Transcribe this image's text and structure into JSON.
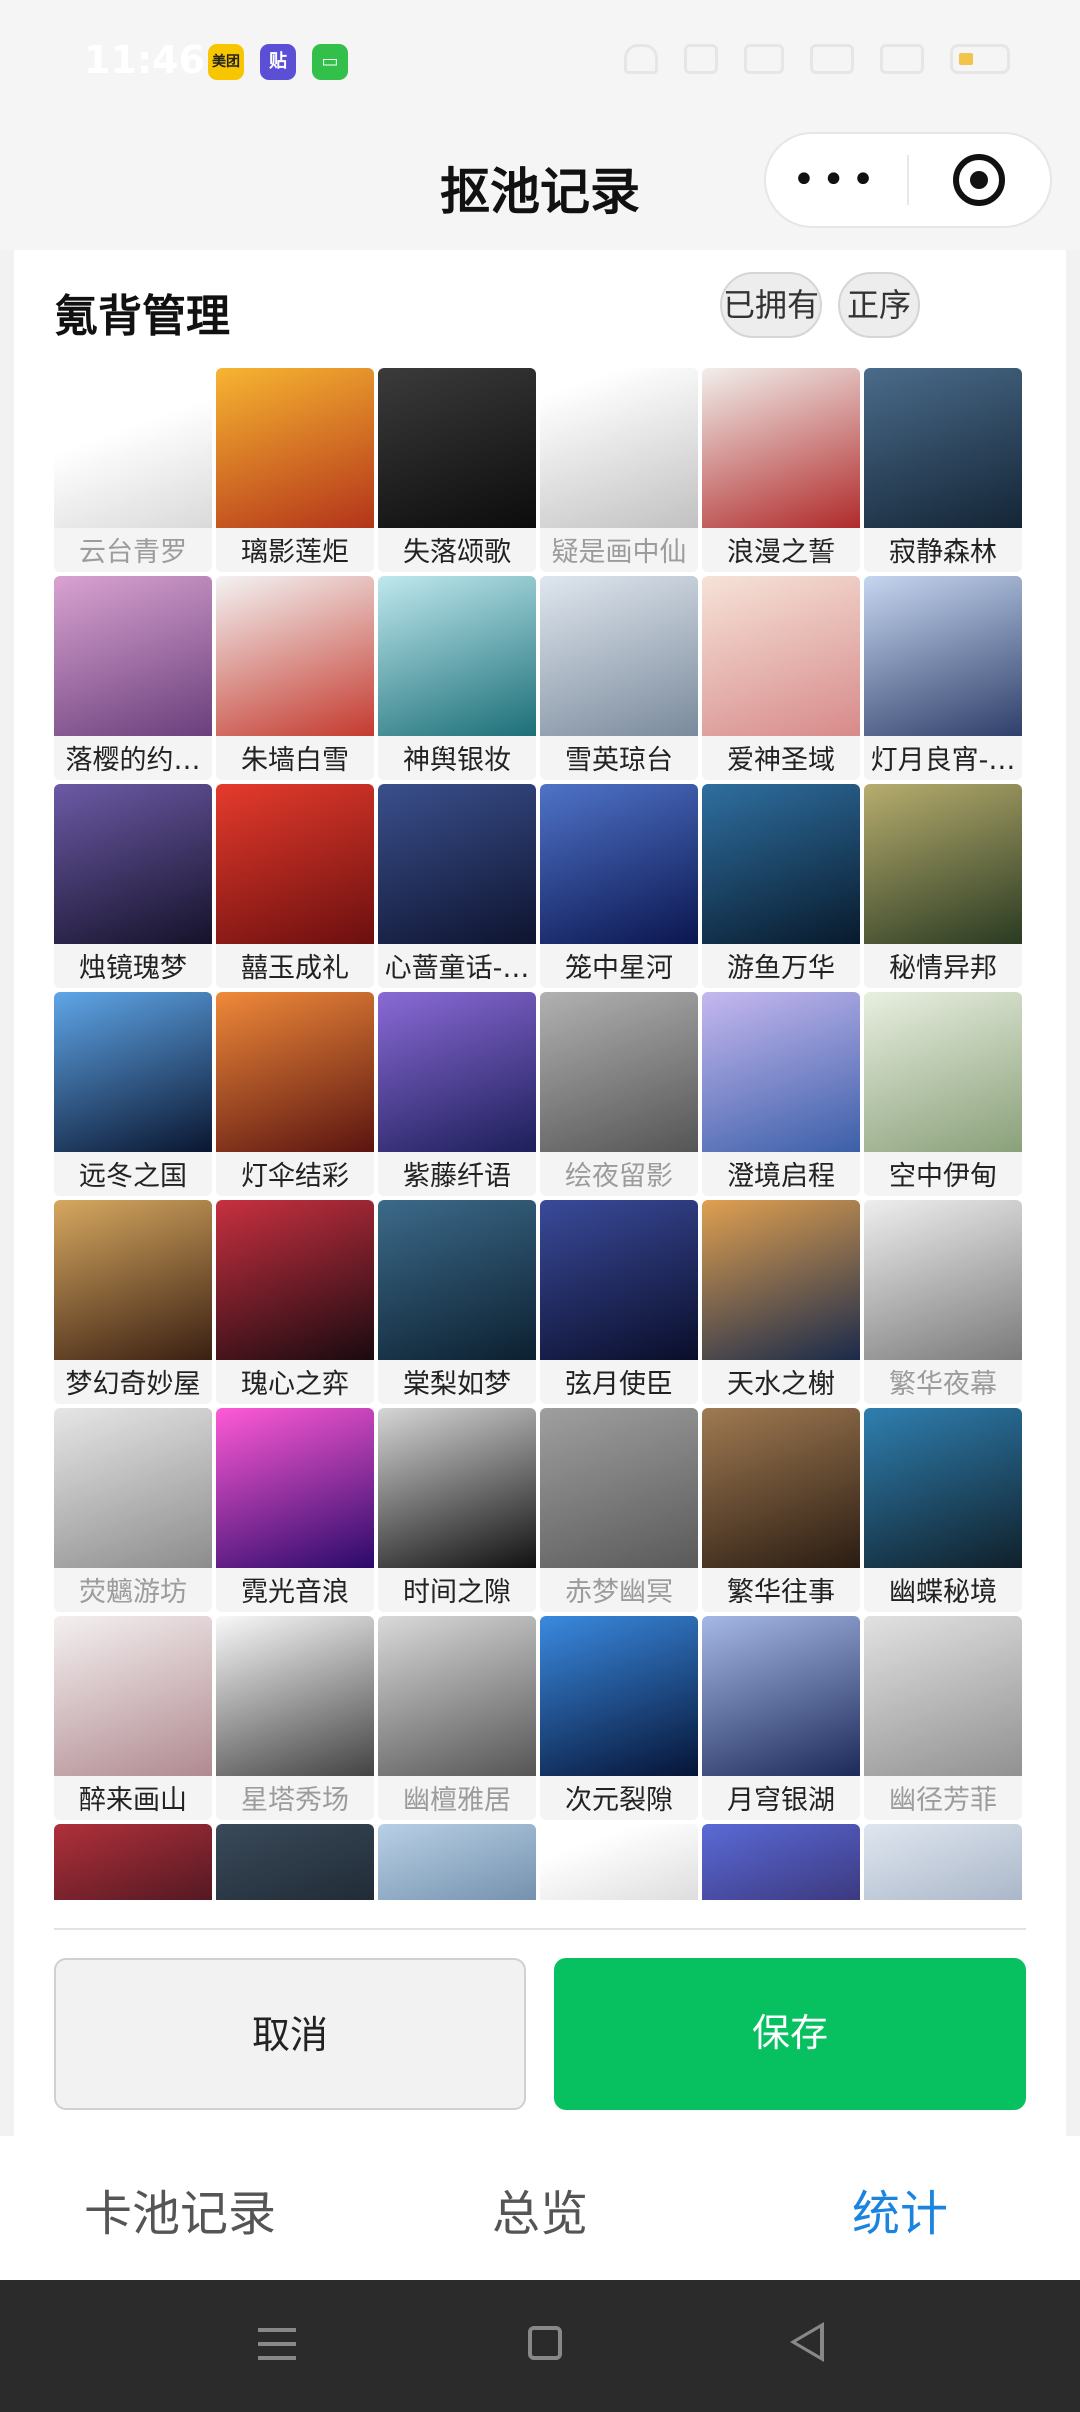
{
  "status_bar": {
    "time": "11:46",
    "apps": [
      {
        "label": "美团",
        "color": "#f7c600"
      },
      {
        "label": "贴",
        "color": "#5b4fd6"
      },
      {
        "label": "",
        "color": "#33c04a"
      }
    ],
    "icons": [
      "headphone-icon",
      "mute-icon",
      "hd-icon",
      "signal-icon",
      "signal-icon",
      "battery-icon"
    ]
  },
  "header": {
    "title": "抠池记录",
    "more_label": "•••"
  },
  "panel": {
    "title": "氪背管理",
    "filter_owned": "已拥有",
    "sort_order": "正序"
  },
  "items": [
    {
      "name": "云台青罗",
      "dim": true,
      "c1": "#f3f3f3",
      "c2": "#bdbdbd"
    },
    {
      "name": "璃影莲炬",
      "dim": false,
      "c1": "#f7b531",
      "c2": "#b3341a"
    },
    {
      "name": "失落颂歌",
      "dim": false,
      "c1": "#3b3b3b",
      "c2": "#0c0c0c"
    },
    {
      "name": "疑是画中仙",
      "dim": true,
      "c1": "#e6e6e6",
      "c2": "#a8a8a8"
    },
    {
      "name": "浪漫之誓",
      "dim": false,
      "c1": "#f1efec",
      "c2": "#b02a2a"
    },
    {
      "name": "寂静森林",
      "dim": false,
      "c1": "#4a6b8a",
      "c2": "#142536"
    },
    {
      "name": "落樱的约…",
      "dim": false,
      "c1": "#d9a3d1",
      "c2": "#6a3f7c"
    },
    {
      "name": "朱墙白雪",
      "dim": false,
      "c1": "#f3f3f3",
      "c2": "#c43a2e"
    },
    {
      "name": "神舆银妆",
      "dim": false,
      "c1": "#bfe8ee",
      "c2": "#1c6f78"
    },
    {
      "name": "雪英琼台",
      "dim": false,
      "c1": "#dfe6ee",
      "c2": "#7a8a9c"
    },
    {
      "name": "爱神圣域",
      "dim": false,
      "c1": "#f6e3d8",
      "c2": "#d78a8a"
    },
    {
      "name": "灯月良宵-…",
      "dim": false,
      "c1": "#c6d6f0",
      "c2": "#2f3f6a"
    },
    {
      "name": "烛镜瑰梦",
      "dim": false,
      "c1": "#6c5aa6",
      "c2": "#15122a"
    },
    {
      "name": "囍玉成礼",
      "dim": false,
      "c1": "#e53b2c",
      "c2": "#6b0f0f"
    },
    {
      "name": "心蔷童话-…",
      "dim": false,
      "c1": "#3a4f8c",
      "c2": "#0e1430"
    },
    {
      "name": "笼中星河",
      "dim": false,
      "c1": "#4f73c8",
      "c2": "#0b1650"
    },
    {
      "name": "游鱼万华",
      "dim": false,
      "c1": "#2f6fa0",
      "c2": "#081a2c"
    },
    {
      "name": "秘情异邦",
      "dim": false,
      "c1": "#b7ad6e",
      "c2": "#2a3a22"
    },
    {
      "name": "远冬之国",
      "dim": false,
      "c1": "#5fa6e8",
      "c2": "#0a1630"
    },
    {
      "name": "灯伞结彩",
      "dim": false,
      "c1": "#f08a3a",
      "c2": "#5a1410"
    },
    {
      "name": "紫藤纤语",
      "dim": false,
      "c1": "#8a6ad6",
      "c2": "#1d1f5a"
    },
    {
      "name": "绘夜留影",
      "dim": true,
      "c1": "#9a9a9a",
      "c2": "#4a4a4a"
    },
    {
      "name": "澄境启程",
      "dim": false,
      "c1": "#c6b8f0",
      "c2": "#3b5fa8"
    },
    {
      "name": "空中伊甸",
      "dim": false,
      "c1": "#e8efe0",
      "c2": "#8aa07a"
    },
    {
      "name": "梦幻奇妙屋",
      "dim": false,
      "c1": "#d6a860",
      "c2": "#3a1f12"
    },
    {
      "name": "瑰心之弈",
      "dim": false,
      "c1": "#c83040",
      "c2": "#1a0a10"
    },
    {
      "name": "棠梨如梦",
      "dim": false,
      "c1": "#3c6a8a",
      "c2": "#0c2030"
    },
    {
      "name": "弦月使臣",
      "dim": false,
      "c1": "#3a4a9a",
      "c2": "#0a0e2a"
    },
    {
      "name": "天水之榭",
      "dim": false,
      "c1": "#e0a050",
      "c2": "#1a2a4a"
    },
    {
      "name": "繁华夜幕",
      "dim": true,
      "c1": "#cfcfcf",
      "c2": "#6a6a6a"
    },
    {
      "name": "荧魑游坊",
      "dim": true,
      "c1": "#c8c8c8",
      "c2": "#7a7a7a"
    },
    {
      "name": "霓光音浪",
      "dim": false,
      "c1": "#ff5ad6",
      "c2": "#2a0a6a"
    },
    {
      "name": "时间之隙",
      "dim": false,
      "c1": "#d6d6d6",
      "c2": "#111111"
    },
    {
      "name": "赤梦幽冥",
      "dim": true,
      "c1": "#8a8a8a",
      "c2": "#4e4e4e"
    },
    {
      "name": "繁华往事",
      "dim": false,
      "c1": "#a07a52",
      "c2": "#2a1c12"
    },
    {
      "name": "幽蝶秘境",
      "dim": false,
      "c1": "#2f7fb0",
      "c2": "#10202a"
    },
    {
      "name": "醉来画山",
      "dim": false,
      "c1": "#f4f0f0",
      "c2": "#b08a90"
    },
    {
      "name": "星塔秀场",
      "dim": true,
      "c1": "#d8d8d8",
      "c2": "#3a3a3a"
    },
    {
      "name": "幽檀雅居",
      "dim": true,
      "c1": "#bdbdbd",
      "c2": "#4a4a4a"
    },
    {
      "name": "次元裂隙",
      "dim": false,
      "c1": "#3a8ae0",
      "c2": "#061436"
    },
    {
      "name": "月穹银湖",
      "dim": false,
      "c1": "#a6b8e6",
      "c2": "#1c2a5a"
    },
    {
      "name": "幽径芳菲",
      "dim": true,
      "c1": "#c4c4c4",
      "c2": "#7e7e7e"
    },
    {
      "name": "",
      "dim": false,
      "c1": "#b0303a",
      "c2": "#1a0a14"
    },
    {
      "name": "",
      "dim": false,
      "c1": "#3a4a5a",
      "c2": "#101820"
    },
    {
      "name": "",
      "dim": false,
      "c1": "#b8d0e6",
      "c2": "#4a6a8a"
    },
    {
      "name": "",
      "dim": true,
      "c1": "#e8e8e8",
      "c2": "#a8a8a8"
    },
    {
      "name": "",
      "dim": false,
      "c1": "#5a6ad6",
      "c2": "#2a1a4a"
    },
    {
      "name": "",
      "dim": false,
      "c1": "#dfe6f0",
      "c2": "#8a9ab0"
    }
  ],
  "actions": {
    "cancel": "取消",
    "save": "保存"
  },
  "tabs": {
    "records": "卡池记录",
    "overview": "总览",
    "stats": "统计"
  },
  "colors": {
    "save_green": "#07c160",
    "active_tab_blue": "#1a84e0"
  }
}
